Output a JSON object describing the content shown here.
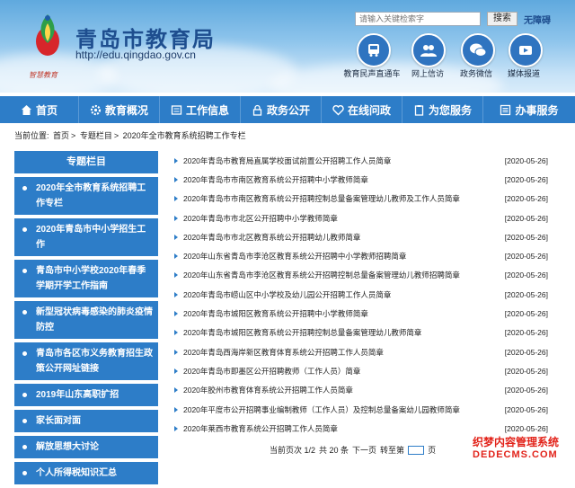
{
  "header": {
    "site_name": "青岛市教育局",
    "site_url": "http://edu.qingdao.gov.cn",
    "slogan": "智慧教育",
    "search_placeholder": "请输入关键检索字",
    "search_button": "搜索",
    "accessibility": "无障碍",
    "quick_links": [
      {
        "label": "教育民声直通车",
        "icon": "bus-icon"
      },
      {
        "label": "网上信访",
        "icon": "users-icon"
      },
      {
        "label": "政务微信",
        "icon": "wechat-icon"
      },
      {
        "label": "媒体报道",
        "icon": "video-icon"
      }
    ]
  },
  "nav": [
    {
      "label": "首页",
      "icon": "home-icon"
    },
    {
      "label": "教育概况",
      "icon": "gear-icon"
    },
    {
      "label": "工作信息",
      "icon": "document-icon"
    },
    {
      "label": "政务公开",
      "icon": "lock-icon"
    },
    {
      "label": "在线问政",
      "icon": "heart-icon"
    },
    {
      "label": "为您服务",
      "icon": "clipboard-icon"
    },
    {
      "label": "办事服务",
      "icon": "list-icon"
    }
  ],
  "breadcrumb": {
    "prefix": "当前位置:",
    "items": [
      "首页",
      "专题栏目",
      "2020年全市教育系统招聘工作专栏"
    ]
  },
  "sidebar": {
    "title": "专题栏目",
    "items": [
      "2020年全市教育系统招聘工作专栏",
      "2020年青岛市中小学招生工作",
      "青岛市中小学校2020年春季学期开学工作指南",
      "新型冠状病毒感染的肺炎疫情防控",
      "青岛市各区市义务教育招生政策公开网址链接",
      "2019年山东高职扩招",
      "家长面对面",
      "解放思想大讨论",
      "个人所得税知识汇总"
    ]
  },
  "articles": [
    {
      "title": "2020年青岛市教育局直属学校面试前置公开招聘工作人员简章",
      "date": "[2020-05-26]"
    },
    {
      "title": "2020年青岛市市南区教育系统公开招聘中小学教师简章",
      "date": "[2020-05-26]"
    },
    {
      "title": "2020年青岛市市南区教育系统公开招聘控制总量备案管理幼儿教师及工作人员简章",
      "date": "[2020-05-26]"
    },
    {
      "title": "2020年青岛市市北区公开招聘中小学教师简章",
      "date": "[2020-05-26]"
    },
    {
      "title": "2020年青岛市市北区教育系统公开招聘幼儿教师简章",
      "date": "[2020-05-26]"
    },
    {
      "title": "2020年山东省青岛市李沧区教育系统公开招聘中小学教师招聘简章",
      "date": "[2020-05-26]"
    },
    {
      "title": "2020年山东省青岛市李沧区教育系统公开招聘控制总量备案管理幼儿教师招聘简章",
      "date": "[2020-05-26]"
    },
    {
      "title": "2020年青岛市崂山区中小学校及幼儿园公开招聘工作人员简章",
      "date": "[2020-05-26]"
    },
    {
      "title": "2020年青岛市城阳区教育系统公开招聘中小学教师简章",
      "date": "[2020-05-26]"
    },
    {
      "title": "2020年青岛市城阳区教育系统公开招聘控制总量备案管理幼儿教师简章",
      "date": "[2020-05-26]"
    },
    {
      "title": "2020年青岛西海岸新区教育体育系统公开招聘工作人员简章",
      "date": "[2020-05-26]"
    },
    {
      "title": "2020年青岛市即墨区公开招聘教师（工作人员）简章",
      "date": "[2020-05-26]"
    },
    {
      "title": "2020年胶州市教育体育系统公开招聘工作人员简章",
      "date": "[2020-05-26]"
    },
    {
      "title": "2020年平度市公开招聘事业编制教师（工作人员）及控制总量备案幼儿园教师简章",
      "date": "[2020-05-26]"
    },
    {
      "title": "2020年莱西市教育系统公开招聘工作人员简章",
      "date": "[2020-05-26]"
    }
  ],
  "pager": {
    "page_info": "当前页次 1/2",
    "total": "共 20 条",
    "next": "下一页",
    "goto": "转至第",
    "goto_value": "1",
    "page_suffix": "页"
  },
  "watermark": {
    "line1": "织梦内容管理系统",
    "line2": "DEDECMS.COM"
  },
  "colors": {
    "primary": "#2d7dc8",
    "title": "#1e4e8f",
    "watermark": "#e2231a"
  }
}
